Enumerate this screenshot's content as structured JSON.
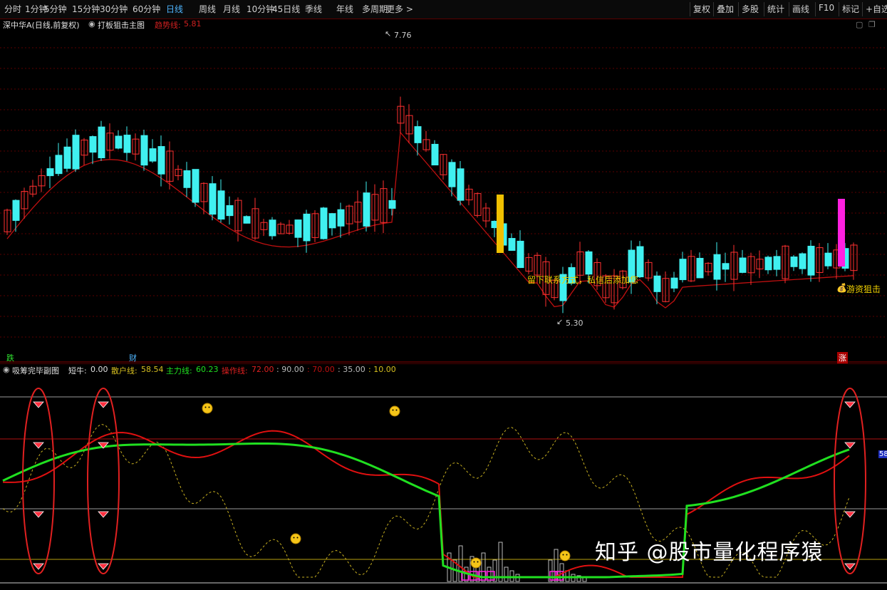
{
  "toolbar": {
    "periods": [
      "分时",
      "1分钟",
      "5分钟",
      "15分钟",
      "30分钟",
      "60分钟",
      "日线",
      "周线",
      "月线",
      "10分钟",
      "45日线",
      "季线",
      "年线",
      "多周期",
      "更多 >"
    ],
    "active_period": "日线",
    "right_buttons": [
      "复权",
      "叠加",
      "多股",
      "统计",
      "画线",
      "F10",
      "标记",
      "+自选"
    ]
  },
  "main": {
    "stock_title": "深中华A(日线,前复权)",
    "indicator_name": "打板狙击主图",
    "trend_label": "趋势线:",
    "trend_value": "5.81",
    "high_label": "7.76",
    "low_label": "5.30",
    "annotation_contact": "留下联系方式，私信后添加您",
    "annotation_hot": "游资狙击",
    "marker_left": "跌",
    "marker_mid": "财",
    "marker_right": "涨"
  },
  "sub": {
    "indicator_name": "吸筹完毕副图",
    "short_label": "短牛:",
    "short_value": "0.00",
    "retail_label": "散户线:",
    "retail_value": "58.54",
    "main_label": "主力线:",
    "main_value": "60.23",
    "op_label": "操作线:",
    "op_value": "72.00",
    "level_90": "90.00",
    "level_70": "70.00",
    "level_35": "35.00",
    "level_10": "10.00",
    "axis_tag": "58"
  },
  "watermark": "知乎 @股市量化程序猿",
  "colors": {
    "up_candle": "#ff3030",
    "down_candle": "#40f0f0",
    "trend_line": "#c01010",
    "active_tab": "#4fb6ff",
    "main_line": "#20e020",
    "op_line": "#e01010",
    "retail_line": "#c8b020",
    "highlight_yellow": "#f0c000",
    "highlight_magenta": "#ff20e0"
  }
}
